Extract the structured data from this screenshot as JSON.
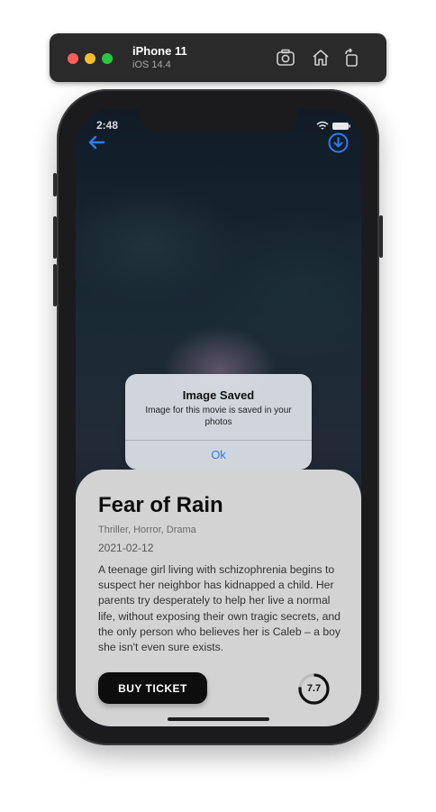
{
  "simulator": {
    "device": "iPhone 11",
    "os": "iOS 14.4",
    "icons": [
      "screenshot-icon",
      "home-icon",
      "rotate-icon"
    ]
  },
  "status_bar": {
    "time": "2:48"
  },
  "nav": {
    "icons": [
      "back-arrow-icon",
      "download-icon"
    ],
    "accent": "#2f7bf5"
  },
  "alert": {
    "title": "Image Saved",
    "message": "Image for this movie is saved in your photos",
    "button": "Ok"
  },
  "movie": {
    "title": "Fear of Rain",
    "genres": "Thriller, Horror, Drama",
    "release_date": "2021-02-12",
    "overview": "A teenage girl living with schizophrenia begins to suspect her neighbor has kidnapped a child. Her parents try desperately to help her live a normal life, without exposing their own tragic secrets, and the only person who believes her is Caleb – a boy she isn't even sure exists.",
    "buy_label": "BUY TICKET",
    "rating": "7.7",
    "rating_fraction": 0.77
  }
}
